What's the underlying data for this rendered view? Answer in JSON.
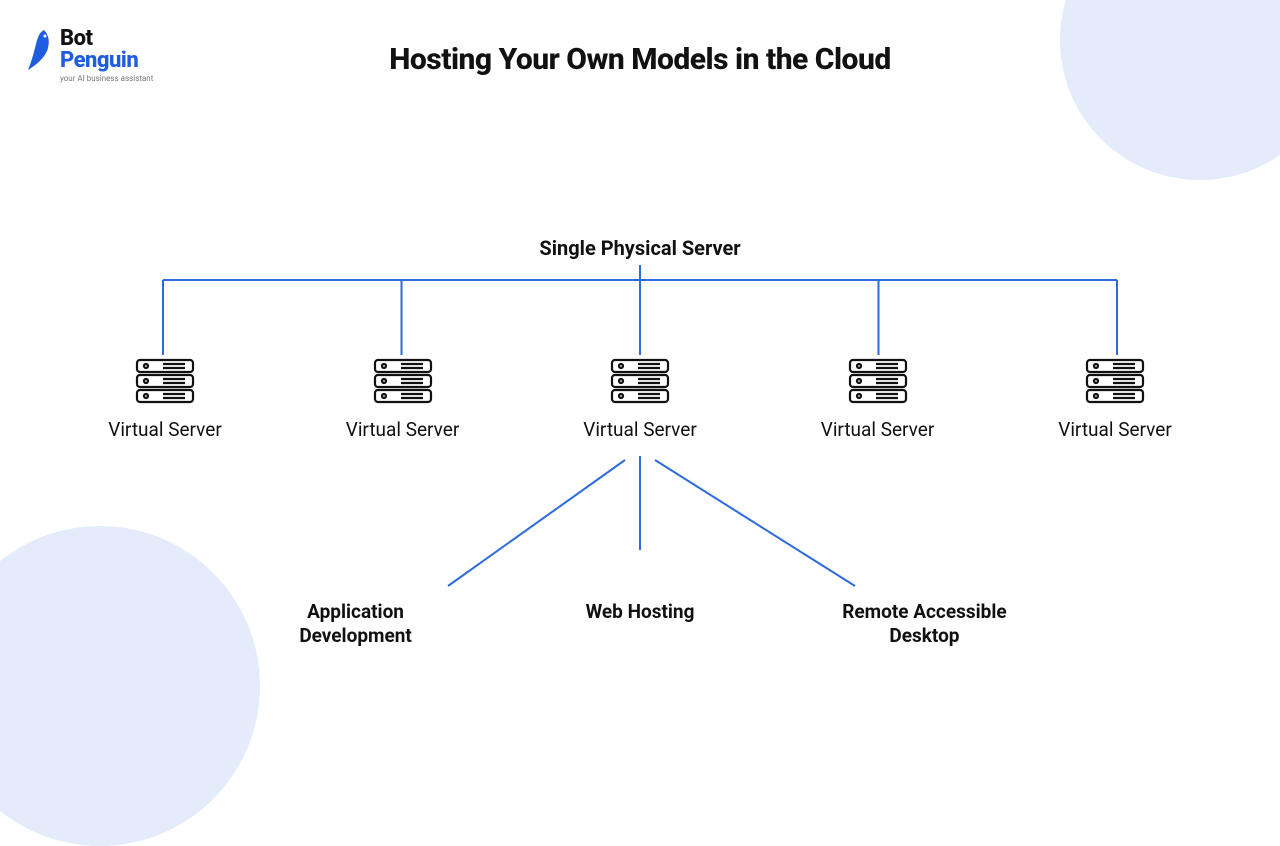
{
  "logo": {
    "line1": "Bot",
    "line2": "Penguin",
    "tagline": "your AI business assistant"
  },
  "title": "Hosting Your Own Models in the Cloud",
  "diagram": {
    "root_label": "Single Physical Server",
    "children": [
      {
        "label": "Virtual Server"
      },
      {
        "label": "Virtual Server"
      },
      {
        "label": "Virtual Server"
      },
      {
        "label": "Virtual Server"
      },
      {
        "label": "Virtual Server"
      }
    ],
    "uses": [
      {
        "label": "Application Development"
      },
      {
        "label": "Web Hosting"
      },
      {
        "label": "Remote Accessible Desktop"
      }
    ],
    "line_color": "#2d6be0",
    "line_width": 2
  }
}
